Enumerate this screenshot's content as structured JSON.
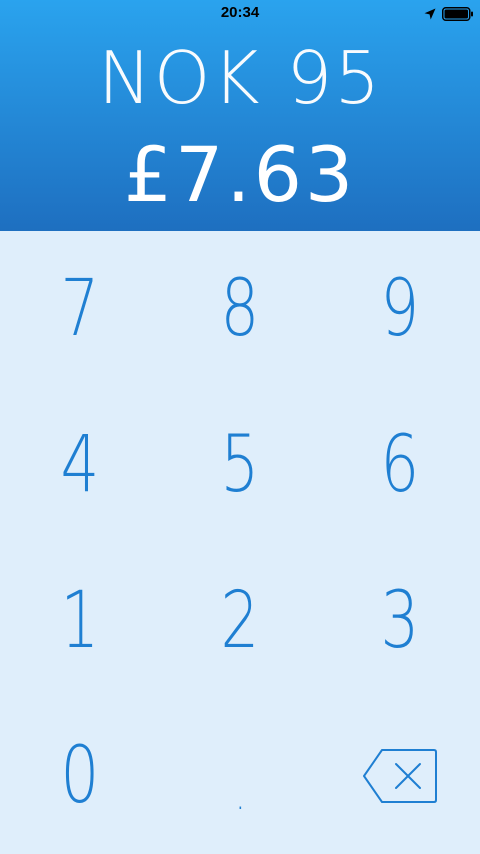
{
  "status_bar": {
    "time": "20:34",
    "icons": [
      "location-arrow-icon",
      "battery-icon"
    ]
  },
  "display": {
    "source_amount": "NOK 95",
    "converted_amount": "£7.63"
  },
  "keypad": {
    "keys": [
      "7",
      "8",
      "9",
      "4",
      "5",
      "6",
      "1",
      "2",
      "3",
      "0",
      "."
    ],
    "backspace_icon": "backspace-icon"
  },
  "colors": {
    "header_top": "#2aa3ee",
    "header_bottom": "#1e6fc0",
    "keypad_bg": "#dfeefb",
    "key_text": "#1f7fd2",
    "amount_text": "#ffffff"
  }
}
